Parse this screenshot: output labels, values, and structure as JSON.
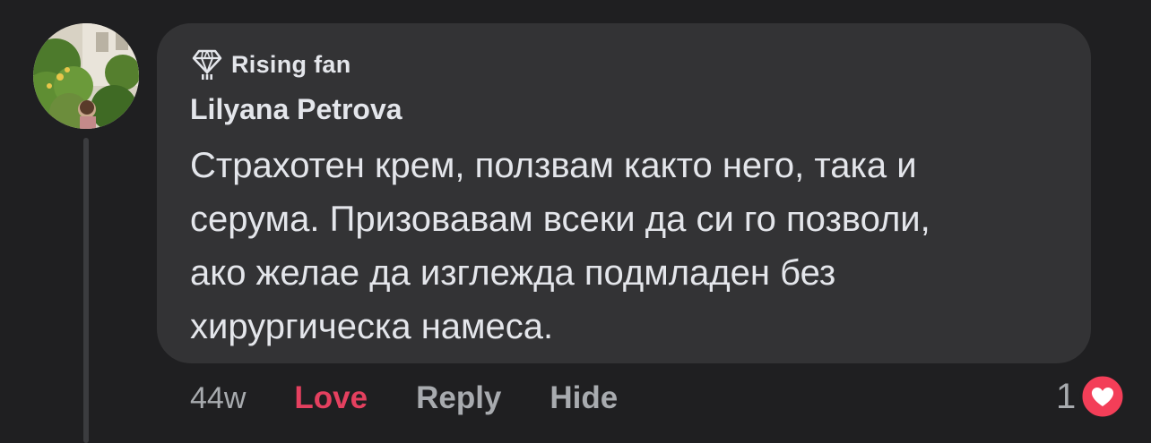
{
  "comment": {
    "badge_label": "Rising fan",
    "author": "Lilyana Petrova",
    "text_lines": [
      "Страхотен крем, ползвам както него, така и",
      "серума. Призовавам всеки да си го позволи,",
      "ако желае да изглежда подмладен без",
      "хирургическа намеса."
    ],
    "time": "44w",
    "actions": {
      "love": "Love",
      "reply": "Reply",
      "hide": "Hide"
    },
    "reaction_count": "1",
    "reaction_type": "heart-icon"
  },
  "colors": {
    "background": "#1f1f21",
    "bubble": "#333335",
    "text": "#e4e6eb",
    "muted": "#a8abaf",
    "love": "#e4405f",
    "heart_badge": "#f33e58"
  },
  "icons": {
    "badge": "diamond-icon",
    "reaction": "heart-icon"
  }
}
